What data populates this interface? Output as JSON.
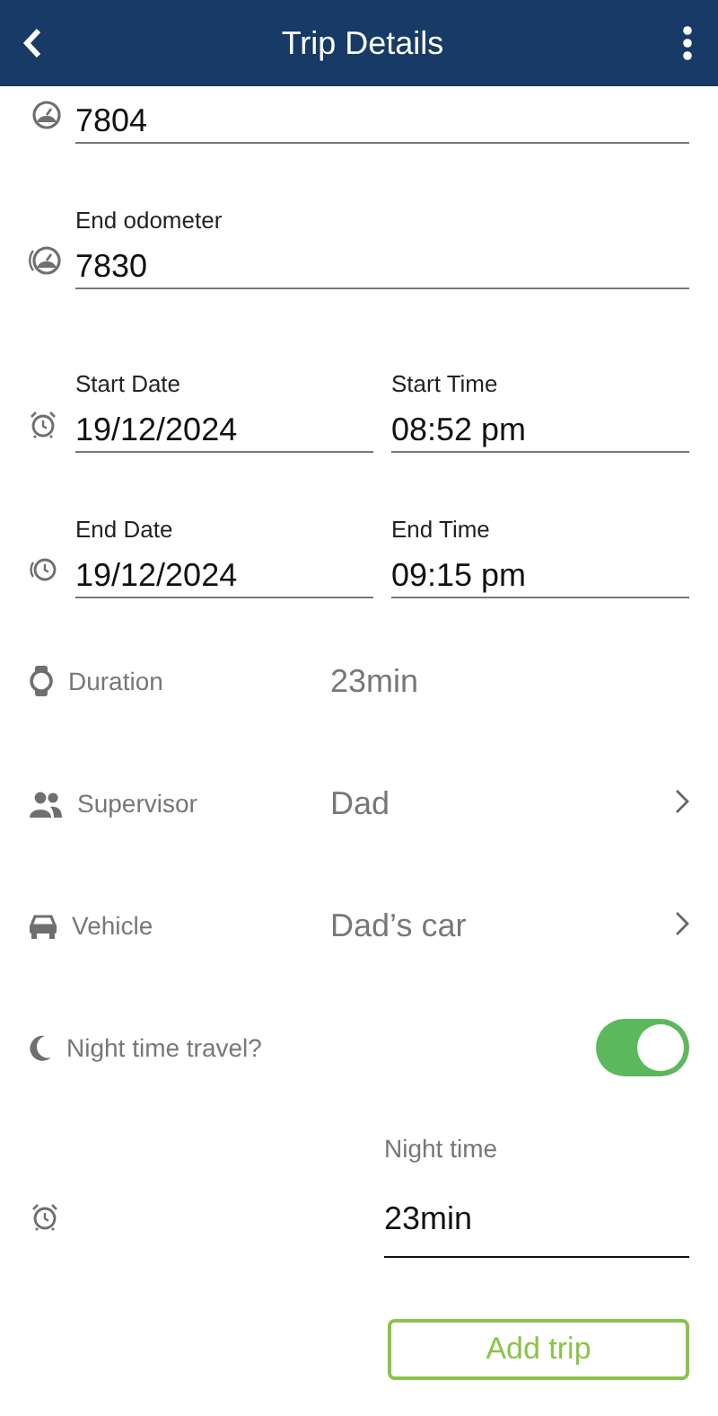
{
  "header": {
    "title": "Trip Details"
  },
  "start_odometer": {
    "value": "7804"
  },
  "end_odometer": {
    "label": "End odometer",
    "value": "7830"
  },
  "date_rows": [
    {
      "kind": "start",
      "date_label": "Start Date",
      "date": "19/12/2024",
      "time_label": "Start Time",
      "time": "08:52 pm"
    },
    {
      "kind": "end",
      "date_label": "End Date",
      "date": "19/12/2024",
      "time_label": "End Time",
      "time": "09:15 pm"
    }
  ],
  "detail_rows": [
    {
      "kind": "duration",
      "label": "Duration",
      "value": "23min"
    },
    {
      "kind": "supervisor",
      "label": "Supervisor",
      "value": "Dad"
    },
    {
      "kind": "vehicle",
      "label": "Vehicle",
      "value": "Dad’s car"
    },
    {
      "kind": "night",
      "label": "Night time travel?",
      "on": true
    }
  ],
  "night_time": {
    "label": "Night time",
    "value": "23min"
  },
  "add_button": {
    "label": "Add trip"
  }
}
